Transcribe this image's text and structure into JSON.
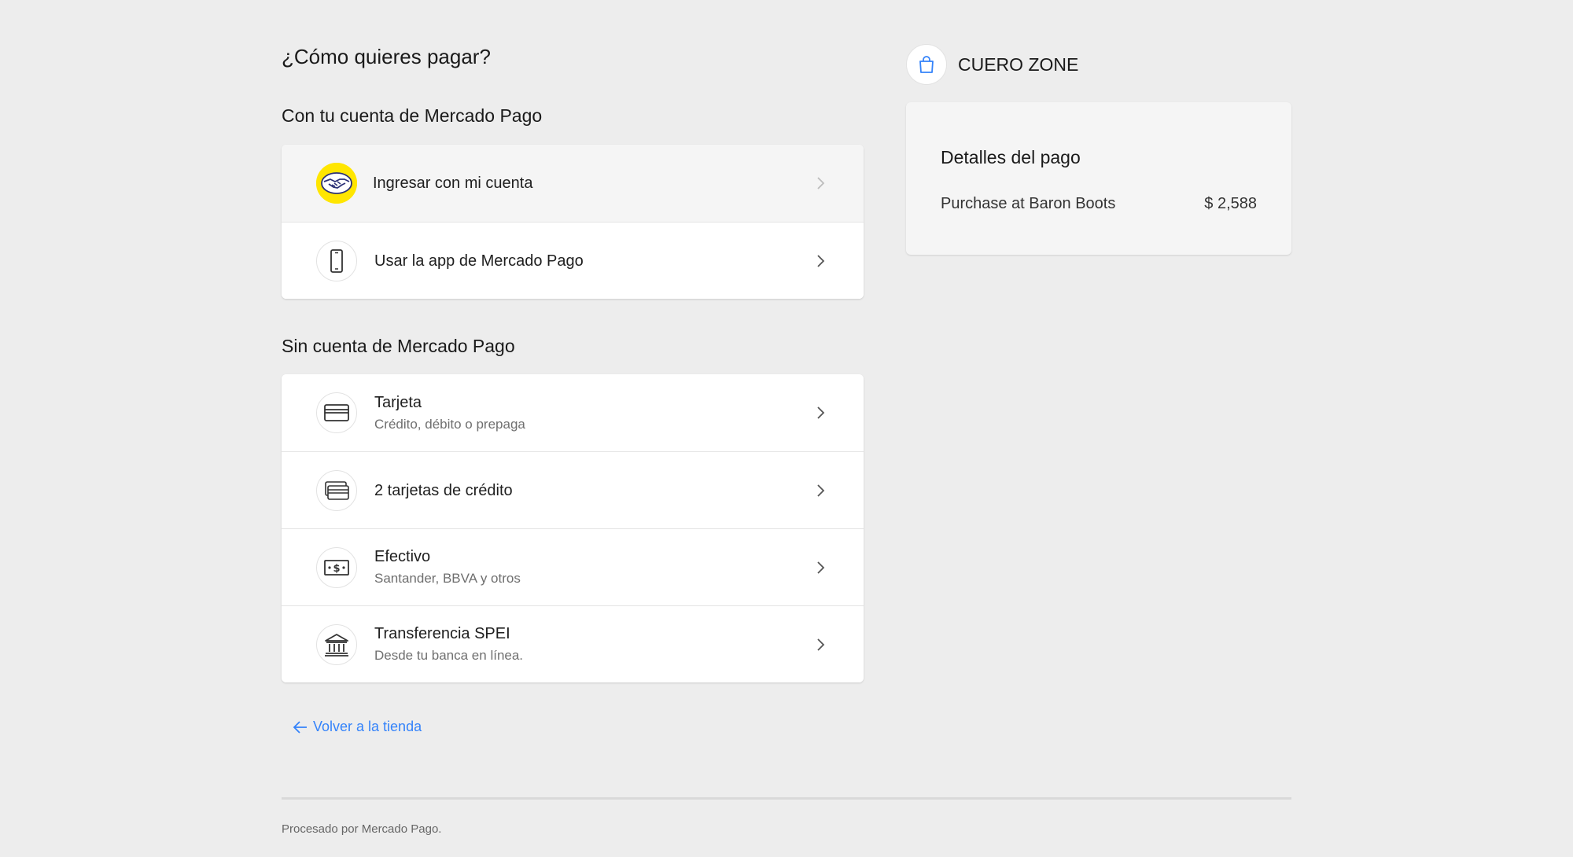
{
  "page": {
    "title": "¿Cómo quieres pagar?"
  },
  "with_account": {
    "title": "Con tu cuenta de Mercado Pago",
    "items": [
      {
        "label": "Ingresar con mi cuenta",
        "icon": "mercado-pago-handshake-icon"
      },
      {
        "label": "Usar la app de Mercado Pago",
        "icon": "smartphone-icon"
      }
    ]
  },
  "without_account": {
    "title": "Sin cuenta de Mercado Pago",
    "items": [
      {
        "label": "Tarjeta",
        "sublabel": "Crédito, débito o prepaga",
        "icon": "credit-card-icon"
      },
      {
        "label": "2 tarjetas de crédito",
        "icon": "two-cards-icon"
      },
      {
        "label": "Efectivo",
        "sublabel": "Santander, BBVA y otros",
        "icon": "cash-icon"
      },
      {
        "label": "Transferencia SPEI",
        "sublabel": "Desde tu banca en línea.",
        "icon": "bank-icon"
      }
    ]
  },
  "back_link": {
    "label": "Volver a la tienda",
    "icon": "arrow-left-icon"
  },
  "store": {
    "name": "CUERO ZONE",
    "icon": "shopping-bag-icon"
  },
  "payment_details": {
    "title": "Detalles del pago",
    "item_label": "Purchase at Baron Boots",
    "item_amount": "$ 2,588"
  },
  "footer": {
    "text": "Procesado por Mercado Pago."
  },
  "colors": {
    "background": "#ededed",
    "accent": "#3483fa",
    "mercado_pago_yellow": "#ffe600",
    "card": "#ffffff"
  }
}
